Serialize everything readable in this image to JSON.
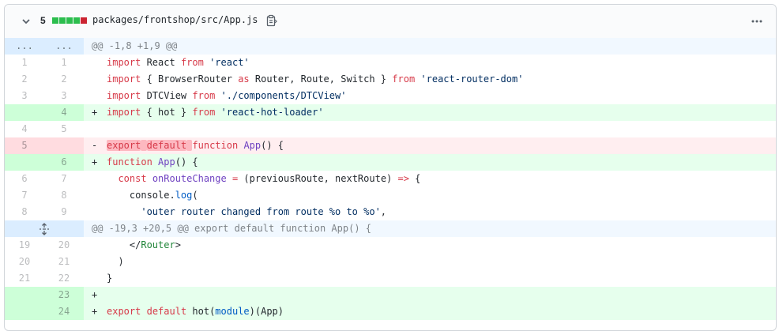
{
  "file": {
    "change_count": "5",
    "path": "packages/frontshop/src/App.js",
    "diffstat_colors": [
      "#2cbe4e",
      "#2cbe4e",
      "#2cbe4e",
      "#2cbe4e",
      "#cb2431"
    ],
    "icons": {
      "collapse": "chevron-down-icon",
      "copy": "clipboard-icon",
      "more": "kebab-horizontal-icon",
      "expand": "unfold-icon"
    }
  },
  "hunks": [
    {
      "left": "...",
      "right": "...",
      "header": "@@ -1,8 +1,9 @@"
    },
    {
      "header": "@@ -19,3 +20,5 @@ export default function App() {"
    }
  ],
  "lines": [
    {
      "old": "1",
      "new": "1",
      "marker": " ",
      "tokens": [
        [
          "import",
          "kw"
        ],
        [
          " React ",
          ""
        ],
        [
          "from",
          "kw"
        ],
        [
          " ",
          ""
        ],
        [
          "'react'",
          "str"
        ]
      ]
    },
    {
      "old": "2",
      "new": "2",
      "marker": " ",
      "tokens": [
        [
          "import",
          "kw"
        ],
        [
          " { BrowserRouter ",
          ""
        ],
        [
          "as",
          "kw"
        ],
        [
          " Router, Route, Switch } ",
          ""
        ],
        [
          "from",
          "kw"
        ],
        [
          " ",
          ""
        ],
        [
          "'react-router-dom'",
          "str"
        ]
      ]
    },
    {
      "old": "3",
      "new": "3",
      "marker": " ",
      "tokens": [
        [
          "import",
          "kw"
        ],
        [
          " DTCView ",
          ""
        ],
        [
          "from",
          "kw"
        ],
        [
          " ",
          ""
        ],
        [
          "'./components/DTCView'",
          "str"
        ]
      ]
    },
    {
      "old": "",
      "new": "4",
      "marker": "+",
      "tokens": [
        [
          "import",
          "kw"
        ],
        [
          " { hot } ",
          ""
        ],
        [
          "from",
          "kw"
        ],
        [
          " ",
          ""
        ],
        [
          "'react-hot-loader'",
          "str"
        ]
      ]
    },
    {
      "old": "4",
      "new": "5",
      "marker": " ",
      "tokens": []
    },
    {
      "old": "5",
      "new": "",
      "marker": "-",
      "tokens": [
        [
          "export",
          "kw hl-del"
        ],
        [
          " ",
          "hl-del"
        ],
        [
          "default",
          "kw hl-del"
        ],
        [
          " ",
          "hl-del"
        ],
        [
          "function",
          "kw"
        ],
        [
          " ",
          ""
        ],
        [
          "App",
          "fn"
        ],
        [
          "() {",
          ""
        ]
      ]
    },
    {
      "old": "",
      "new": "6",
      "marker": "+",
      "tokens": [
        [
          "function",
          "kw"
        ],
        [
          " ",
          ""
        ],
        [
          "App",
          "fn"
        ],
        [
          "() {",
          ""
        ]
      ]
    },
    {
      "old": "6",
      "new": "7",
      "marker": " ",
      "tokens": [
        [
          "  ",
          ""
        ],
        [
          "const",
          "kw"
        ],
        [
          " ",
          ""
        ],
        [
          "onRouteChange",
          "fn"
        ],
        [
          " ",
          ""
        ],
        [
          "=",
          "kw"
        ],
        [
          " (previousRoute, nextRoute) ",
          ""
        ],
        [
          "=>",
          "kw"
        ],
        [
          " {",
          ""
        ]
      ]
    },
    {
      "old": "7",
      "new": "8",
      "marker": " ",
      "tokens": [
        [
          "    console.",
          ""
        ],
        [
          "log",
          "cst"
        ],
        [
          "(",
          ""
        ]
      ]
    },
    {
      "old": "8",
      "new": "9",
      "marker": " ",
      "tokens": [
        [
          "      ",
          ""
        ],
        [
          "'outer router changed from route %o to %o'",
          "str"
        ],
        [
          ",",
          ""
        ]
      ]
    },
    {
      "old": "19",
      "new": "20",
      "marker": " ",
      "tokens": [
        [
          "    </",
          ""
        ],
        [
          "Router",
          "tag"
        ],
        [
          ">",
          ""
        ]
      ]
    },
    {
      "old": "20",
      "new": "21",
      "marker": " ",
      "tokens": [
        [
          "  )",
          ""
        ]
      ]
    },
    {
      "old": "21",
      "new": "22",
      "marker": " ",
      "tokens": [
        [
          "}",
          ""
        ]
      ]
    },
    {
      "old": "",
      "new": "23",
      "marker": "+",
      "tokens": []
    },
    {
      "old": "",
      "new": "24",
      "marker": "+",
      "tokens": [
        [
          "export",
          "kw"
        ],
        [
          " ",
          ""
        ],
        [
          "default",
          "kw"
        ],
        [
          " hot(",
          ""
        ],
        [
          "module",
          "cst"
        ],
        [
          ")(App)",
          ""
        ]
      ]
    }
  ]
}
